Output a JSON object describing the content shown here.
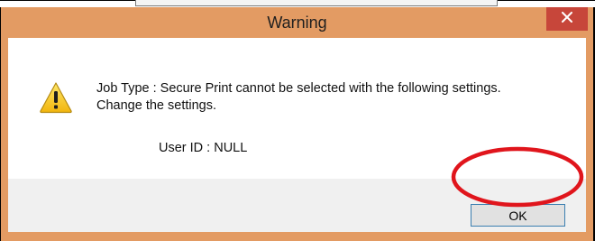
{
  "dialog": {
    "title": "Warning",
    "message_line1": "Job Type : Secure Print cannot be selected with the following settings.",
    "message_line2": "Change the settings.",
    "detail": "User ID : NULL",
    "ok_label": "OK",
    "close_glyph": "✕"
  },
  "icons": {
    "title_close": "close-icon",
    "message": "warning-icon"
  },
  "colors": {
    "titlebar": "#e39b63",
    "close_button": "#c7463a",
    "annotation_ring": "#e0151c",
    "footer": "#f0f0f0"
  }
}
